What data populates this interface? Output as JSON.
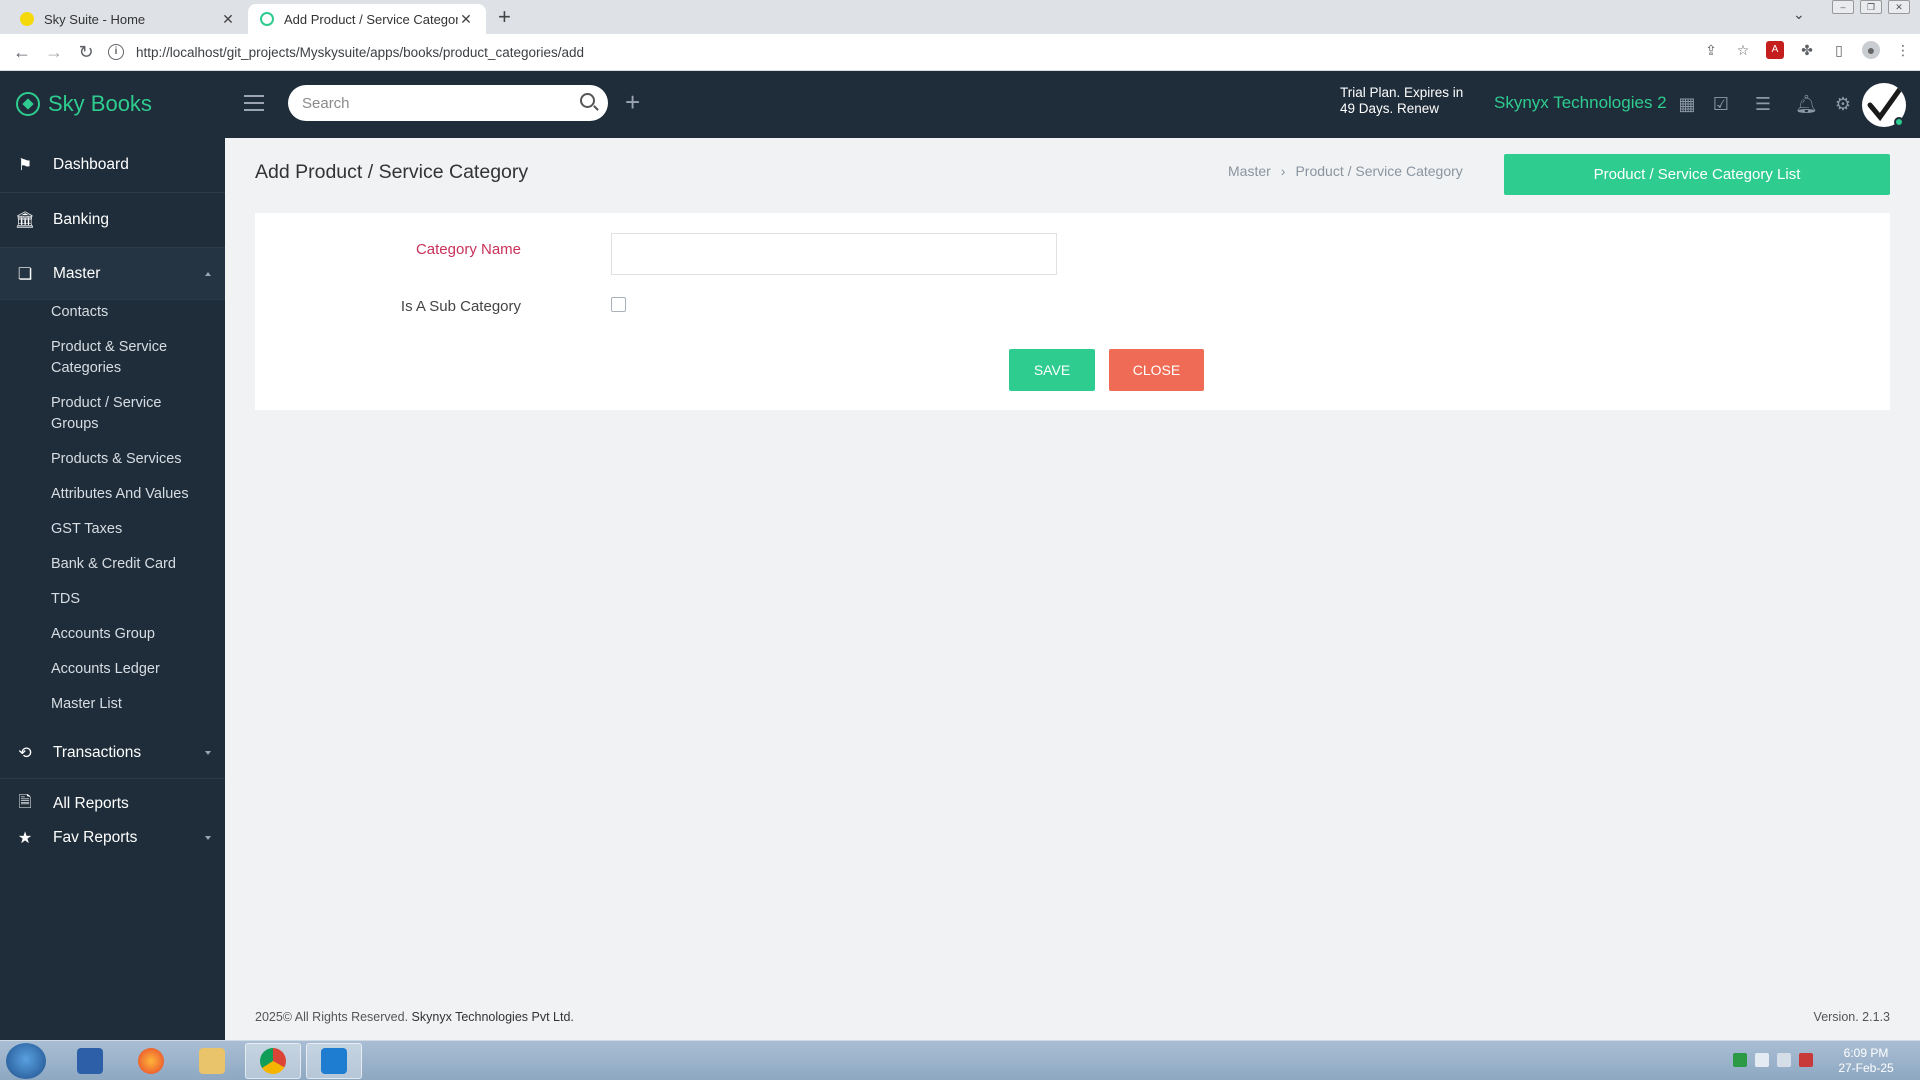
{
  "browser": {
    "tabs": [
      {
        "title": "Sky Suite - Home",
        "close": "✕"
      },
      {
        "title": "Add Product / Service Category",
        "close": "✕"
      }
    ],
    "new_tab": "+",
    "url": "http://localhost/git_projects/Myskysuite/apps/books/product_categories/add"
  },
  "header": {
    "brand": "Sky Books",
    "search_placeholder": "Search",
    "trial_line1": "Trial Plan. Expires in",
    "trial_line2": "49 Days. Renew",
    "company": "Skynyx Technologies 2"
  },
  "sidebar": {
    "dashboard": "Dashboard",
    "banking": "Banking",
    "master": "Master",
    "master_items": [
      "Contacts",
      "Product & Service Categories",
      "Product / Service Groups",
      "Products & Services",
      "Attributes And Values",
      "GST Taxes",
      "Bank & Credit Card",
      "TDS",
      "Accounts Group",
      "Accounts Ledger",
      "Master List"
    ],
    "transactions": "Transactions",
    "all_reports": "All Reports",
    "fav_reports": "Fav Reports"
  },
  "page": {
    "title": "Add Product / Service Category",
    "breadcrumb": [
      "Master",
      "Product / Service Category"
    ],
    "breadcrumb_sep": "›",
    "list_button": "Product / Service Category List"
  },
  "form": {
    "category_name_label": "Category Name",
    "category_name_value": "",
    "is_sub_label": "Is A Sub Category",
    "is_sub_checked": false,
    "save": "SAVE",
    "close": "CLOSE"
  },
  "footer": {
    "copyright": "2025© All Rights Reserved.",
    "company": "Skynyx Technologies Pvt Ltd.",
    "version": "Version. 2.1.3"
  },
  "taskbar": {
    "time": "6:09 PM",
    "date": "27-Feb-25"
  },
  "colors": {
    "accent": "#2ecc8f",
    "danger": "#ef6b55",
    "sidebar": "#1f2d3a",
    "required_label": "#c8325a"
  }
}
